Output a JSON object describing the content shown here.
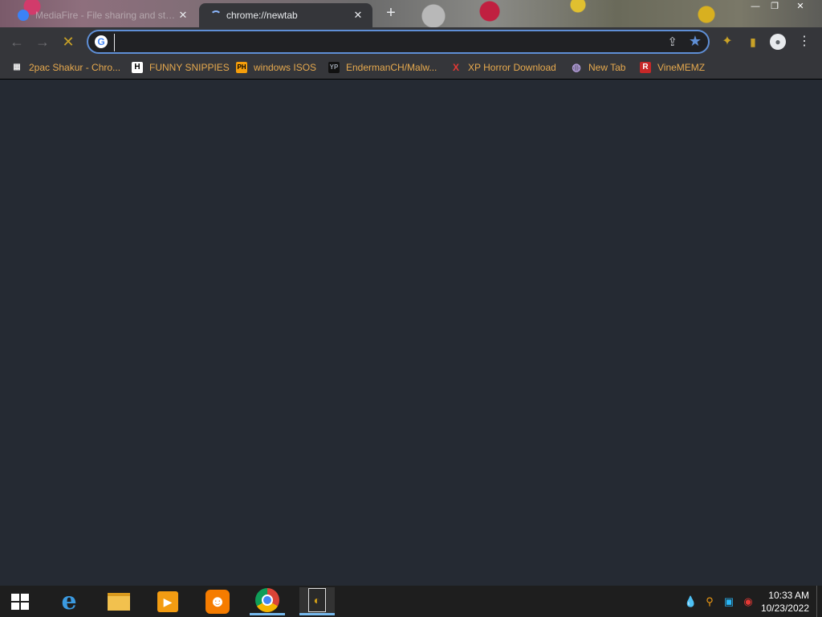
{
  "tabs": [
    {
      "title": "MediaFire - File sharing and storage",
      "state": "inactive",
      "close": "✕"
    },
    {
      "title": "chrome://newtab",
      "state": "active-loading",
      "close": "✕"
    }
  ],
  "new_tab_symbol": "+",
  "window_controls": {
    "minimize": "—",
    "maximize": "❐",
    "close": "✕"
  },
  "toolbar": {
    "back": "←",
    "forward": "→",
    "stop": "✕",
    "address_value": "",
    "address_placeholder": "",
    "google_glyph": "G",
    "share": "⇪",
    "bookmark_star": "★",
    "extensions": "✦",
    "side_panel": "▮",
    "profile": "●",
    "menu": "⋮"
  },
  "bookmarks": [
    {
      "label": "2pac Shakur - Chro...",
      "icon": "2pac-chrome-icon",
      "glyph": "▦",
      "color": "#e8e8e8"
    },
    {
      "label": "FUNNY SNIPPIES",
      "icon": "h-icon",
      "glyph": "H",
      "color": "#ffffff"
    },
    {
      "label": "windows ISOS",
      "icon": "ph-icon",
      "glyph": "PH",
      "color": "#f59e0b"
    },
    {
      "label": "EndermanCH/Malw...",
      "icon": "github-yp-icon",
      "glyph": "YP",
      "color": "#9ca3af"
    },
    {
      "label": "XP Horror Download",
      "icon": "x-icon",
      "glyph": "X",
      "color": "#e53935"
    },
    {
      "label": "New Tab",
      "icon": "globe-icon",
      "glyph": "◍",
      "color": "#b39ddb"
    },
    {
      "label": "VineMEMZ",
      "icon": "r-icon",
      "glyph": "R",
      "color": "#c62828"
    }
  ],
  "taskbar": {
    "apps": [
      {
        "name": "internet-explorer",
        "glyph": "e",
        "color": "#3b9ae1"
      },
      {
        "name": "file-explorer",
        "glyph": "▬",
        "color": "#f2c14e"
      },
      {
        "name": "media-player",
        "glyph": "▶",
        "color": "#f39c12"
      },
      {
        "name": "uc-browser",
        "glyph": "☻",
        "color": "#f57c00"
      },
      {
        "name": "google-chrome",
        "glyph": "◉",
        "color": "#db4437"
      },
      {
        "name": "document-app",
        "glyph": "◐",
        "color": "#d4a017"
      }
    ],
    "time": "10:33 AM",
    "date": "10/23/2022"
  }
}
